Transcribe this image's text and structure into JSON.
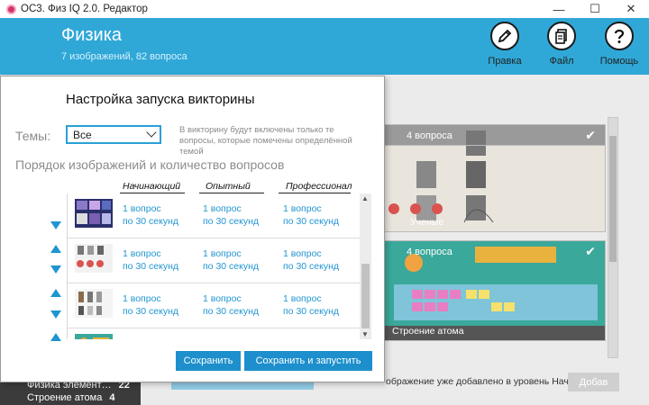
{
  "window": {
    "title": "ОС3. Физ IQ 2.0. Редактор",
    "minimize": "—",
    "maximize": "☐",
    "close": "✕"
  },
  "header": {
    "title": "Физика",
    "subtitle": "7 изображений, 82 вопроса",
    "buttons": [
      {
        "label": "Правка",
        "icon": "pencil-icon"
      },
      {
        "label": "Файл",
        "icon": "document-icon"
      },
      {
        "label": "Помощь",
        "icon": "question-icon"
      }
    ]
  },
  "background": {
    "cards": [
      {
        "badge": "4 вопроса",
        "caption": "Ученые"
      },
      {
        "badge": "4 вопроса",
        "caption": "Строение атома"
      }
    ],
    "left_items": [
      {
        "label": "Физика элемент…",
        "count": "22"
      },
      {
        "label": "Строение атома",
        "count": "4"
      }
    ],
    "hint": "ображение уже добавлено в уровень Начинающий",
    "add_button": "Добав"
  },
  "modal": {
    "title": "Настройка запуска викторины",
    "topics_label": "Темы:",
    "topics_value": "Все",
    "topics_note": "В викторину будут включены только те вопросы, которые помечены определённой темой",
    "order_heading": "Порядок изображений и количество вопросов",
    "columns": [
      "Начинающий",
      "Опытный",
      "Профессионал"
    ],
    "cell_line1": "1 вопрос",
    "cell_line2": "по 30 секунд",
    "save": "Сохранить",
    "save_and_run": "Сохранить и запустить"
  },
  "colors": {
    "accent": "#2fa8d8",
    "button": "#1d8fcc",
    "link": "#2296d2"
  }
}
